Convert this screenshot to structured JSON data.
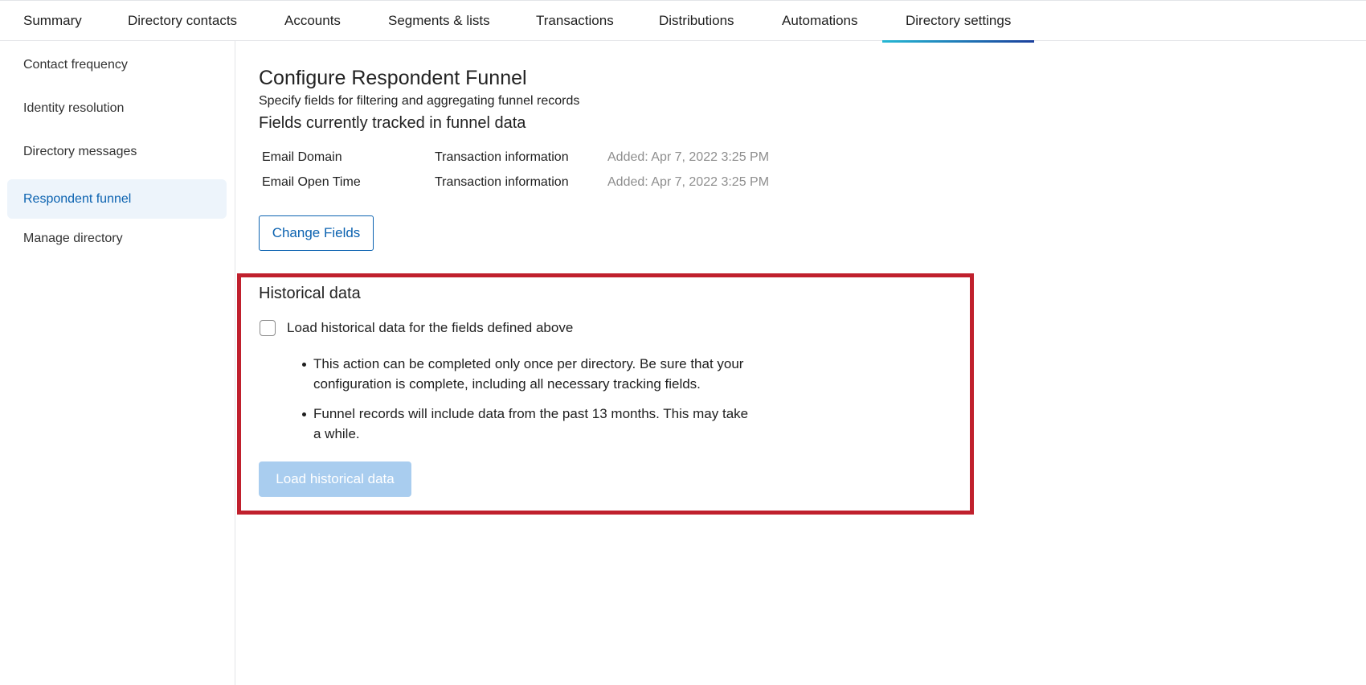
{
  "tabs": [
    {
      "label": "Summary",
      "active": false
    },
    {
      "label": "Directory contacts",
      "active": false
    },
    {
      "label": "Accounts",
      "active": false
    },
    {
      "label": "Segments & lists",
      "active": false
    },
    {
      "label": "Transactions",
      "active": false
    },
    {
      "label": "Distributions",
      "active": false
    },
    {
      "label": "Automations",
      "active": false
    },
    {
      "label": "Directory settings",
      "active": true
    }
  ],
  "sidebar": {
    "items": [
      {
        "label": "Contact frequency",
        "active": false
      },
      {
        "label": "Identity resolution",
        "active": false
      },
      {
        "label": "Directory messages",
        "active": false
      },
      {
        "label": "Respondent funnel",
        "active": true
      },
      {
        "label": "Manage directory",
        "active": false
      }
    ]
  },
  "main": {
    "title": "Configure Respondent Funnel",
    "subtitle": "Specify fields for filtering and aggregating funnel records",
    "tracked_heading": "Fields currently tracked in funnel data",
    "fields": [
      {
        "name": "Email Domain",
        "category": "Transaction information",
        "added": "Added: Apr 7, 2022 3:25 PM"
      },
      {
        "name": "Email Open Time",
        "category": "Transaction information",
        "added": "Added: Apr 7, 2022 3:25 PM"
      }
    ],
    "change_fields_label": "Change Fields"
  },
  "historical": {
    "heading": "Historical data",
    "checkbox_label": "Load historical data for the fields defined above",
    "checked": false,
    "bullets": [
      "This action can be completed only once per directory. Be sure that your configuration is complete, including all necessary tracking fields.",
      "Funnel records will include data from the past 13 months. This may take a while."
    ],
    "load_button_label": "Load historical data",
    "load_button_enabled": false
  },
  "colors": {
    "accent": "#0b62b0",
    "highlight_border": "#c0202d",
    "disabled_button": "#a9cdef",
    "active_sidebar_bg": "#edf4fb"
  }
}
